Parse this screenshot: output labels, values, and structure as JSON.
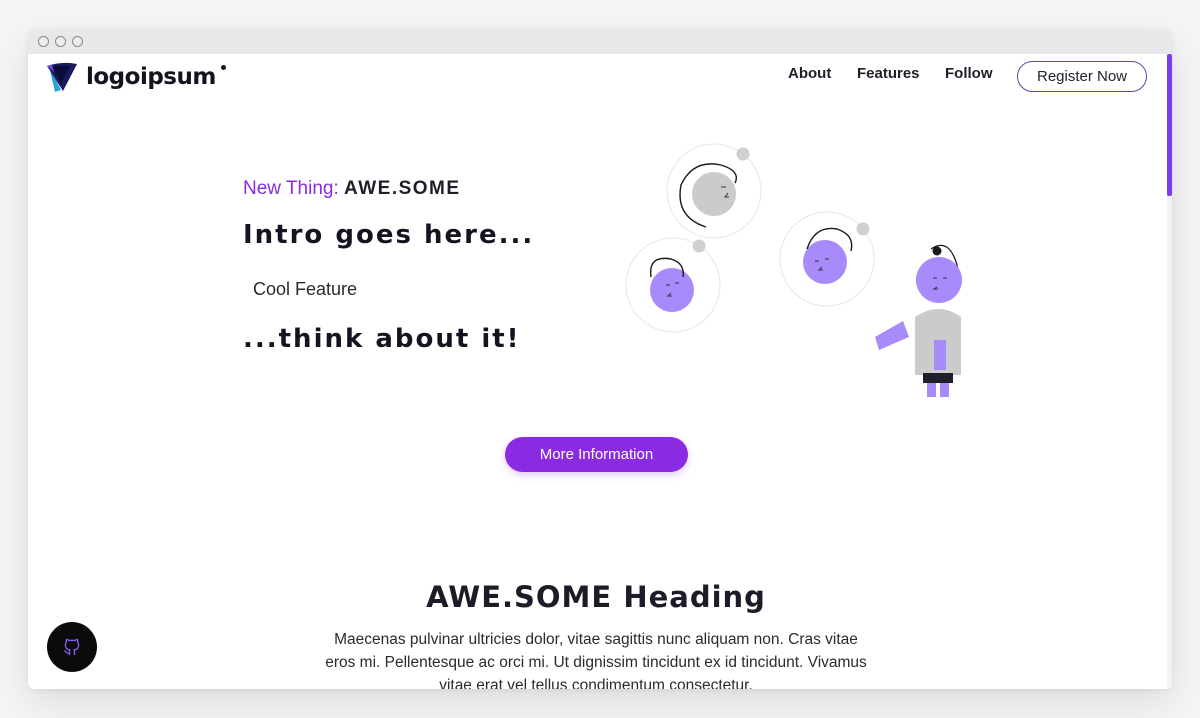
{
  "logo": {
    "text": "logoipsum"
  },
  "nav": {
    "about": "About",
    "features": "Features",
    "follow": "Follow",
    "register": "Register Now"
  },
  "hero": {
    "kicker_lead": "New Thing:",
    "kicker_bold": "AWE.SOME",
    "intro": "Intro goes here...",
    "feature": "Cool Feature",
    "closing": "...think about it!"
  },
  "cta": {
    "label": "More Information"
  },
  "section": {
    "heading": "AWE.SOME Heading",
    "paragraph": "Maecenas pulvinar ultricies dolor, vitae sagittis nunc aliquam non. Cras vitae eros mi. Pellentesque ac orci mi. Ut dignissim tincidunt ex id tincidunt. Vivamus vitae erat vel tellus condimentum consectetur."
  },
  "icons": {
    "github": "github-icon",
    "logo": "logo-mark-icon"
  },
  "colors": {
    "accent": "#8a2be2",
    "illustration_purple": "#a78bfa",
    "illustration_gray": "#cbcbcb"
  }
}
